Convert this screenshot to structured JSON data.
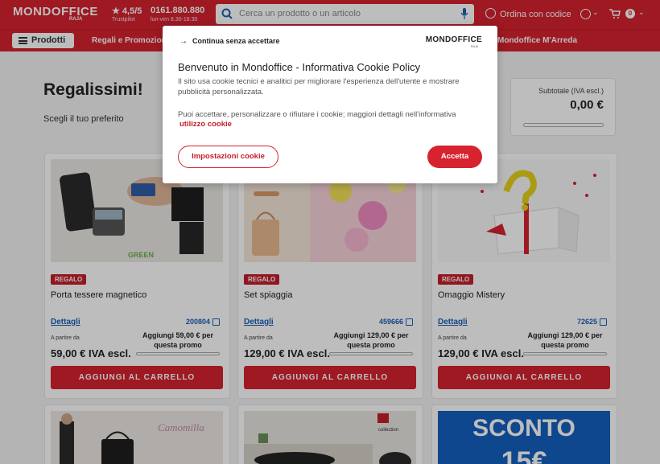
{
  "header": {
    "logo": "MONDOFFICE",
    "logo_sub": "RAJA",
    "rating": "★ 4,5/5",
    "rating_sub": "Trustpilot",
    "phone": "0161.880.880",
    "phone_sub": "lun-ven 8.30-18.30",
    "search_placeholder": "Cerca un prodotto o un articolo",
    "ordina": "Ordina con codice",
    "cart_count": "0"
  },
  "nav": {
    "prodotti": "Prodotti",
    "items": [
      "Regali e Promozioni",
      "Mondoffice M'Arreda"
    ]
  },
  "page": {
    "title": "Regalissimi!",
    "subtitle": "Scegli il tuo preferito",
    "subtotal_label": "Subtotale (IVA escl.)",
    "subtotal_value": "0,00 €"
  },
  "products": [
    {
      "badge": "REGALO",
      "name": "Porta tessere magnetico",
      "details": "Dettagli",
      "code": "200804",
      "from_label": "A partire da",
      "price": "59,00 € IVA escl.",
      "promo": "Aggiungi 59,00 € per questa promo",
      "button": "AGGIUNGI AL CARRELLO"
    },
    {
      "badge": "REGALO",
      "name": "Set spiaggia",
      "details": "Dettagli",
      "code": "459666",
      "from_label": "A partire da",
      "price": "129,00 € IVA escl.",
      "promo": "Aggiungi 129,00 € per questa promo",
      "button": "AGGIUNGI AL CARRELLO"
    },
    {
      "badge": "REGALO",
      "name": "Omaggio Mistery",
      "details": "Dettagli",
      "code": "72625",
      "from_label": "A partire da",
      "price": "129,00 € IVA escl.",
      "promo": "Aggiungi 129,00 € per questa promo",
      "button": "AGGIUNGI AL CARRELLO"
    }
  ],
  "bottom_cards": {
    "brand1": "Camomilla",
    "brand2": "collection",
    "promo_text": "SCONTO",
    "promo_num": "15€"
  },
  "cookie_modal": {
    "skip": "Continua senza accettare",
    "logo": "MONDOFFICE",
    "logo_sub": "RAJA",
    "title": "Benvenuto in Mondoffice - Informativa Cookie Policy",
    "p1": "Il sito usa cookie tecnici e analitici per migliorare l'esperienza dell'utente e mostrare pubblicità personalizzata.",
    "p2": "Puoi accettare, personalizzare o rifiutare i cookie; maggiori dettagli nell'informativa",
    "link": "utilizzo cookie",
    "settings_button": "Impostazioni cookie",
    "accept_button": "Accetta"
  },
  "colors": {
    "brand": "#d6232f",
    "link": "#1a5fb4"
  }
}
